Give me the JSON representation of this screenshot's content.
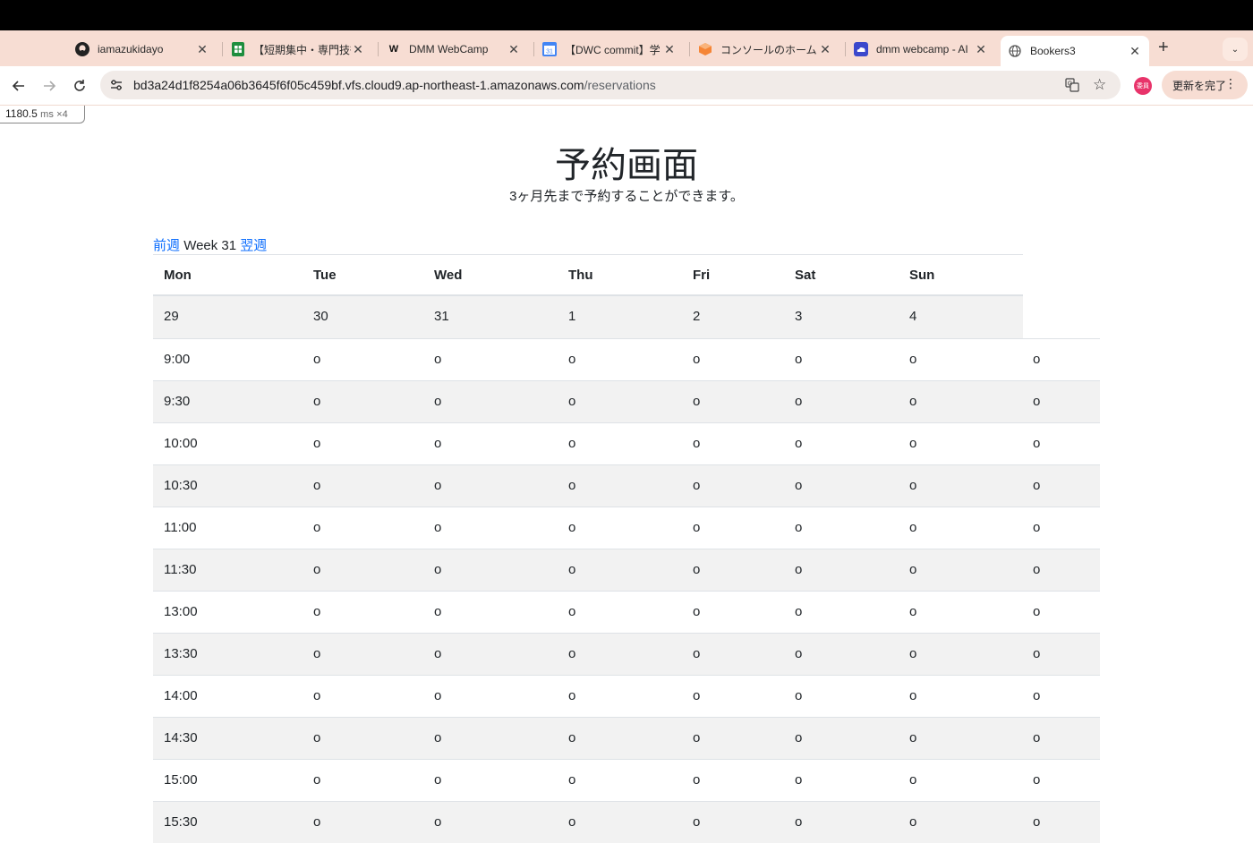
{
  "browser": {
    "tabs": [
      {
        "title": "iamazukidayo",
        "icon": "github-icon"
      },
      {
        "title": "【短期集中・専門技術",
        "icon": "sheets-icon"
      },
      {
        "title": "DMM WebCamp",
        "icon": "webcamp-icon"
      },
      {
        "title": "【DWC commit】学",
        "icon": "calendar-icon"
      },
      {
        "title": "コンソールのホーム |",
        "icon": "aws-cube-icon"
      },
      {
        "title": "dmm webcamp - AI",
        "icon": "cloud-icon"
      },
      {
        "title": "Bookers3",
        "icon": "globe-icon"
      }
    ],
    "active_tab": 6,
    "url_host": "bd3a24d1f8254a06b3645f6f05c459bf.vfs.cloud9.ap-northeast-1.amazonaws.com",
    "url_path": "/reservations",
    "update_label": "更新を完了",
    "avatar_text": "委員"
  },
  "perf": {
    "value": "1180.5",
    "unit": "ms",
    "multiplier": "×4"
  },
  "page": {
    "title": "予約画面",
    "subtitle": "3ヶ月先まで予約することができます。",
    "prev_week": "前週",
    "week_label": "Week 31",
    "next_week": "翌週"
  },
  "calendar": {
    "days": [
      "Mon",
      "Tue",
      "Wed",
      "Thu",
      "Fri",
      "Sat",
      "Sun"
    ],
    "dates": [
      "29",
      "30",
      "31",
      "1",
      "2",
      "3",
      "4"
    ],
    "times": [
      "9:00",
      "9:30",
      "10:00",
      "10:30",
      "11:00",
      "11:30",
      "13:00",
      "13:30",
      "14:00",
      "14:30",
      "15:00",
      "15:30"
    ],
    "slot_mark": "o"
  }
}
